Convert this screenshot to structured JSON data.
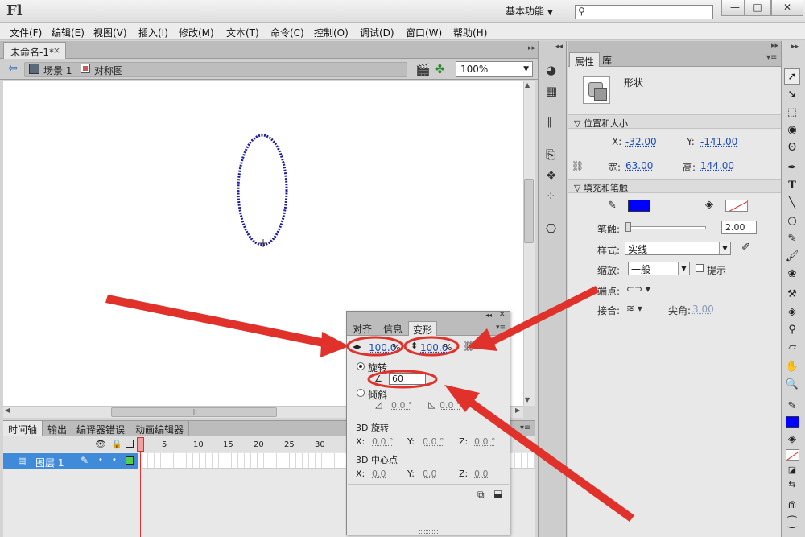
{
  "app": {
    "logo": "Fl",
    "workspace": "基本功能",
    "window_buttons": {
      "minimize": "—",
      "maximize": "□",
      "close": "✕"
    }
  },
  "menu": [
    "文件(F)",
    "编辑(E)",
    "视图(V)",
    "插入(I)",
    "修改(M)",
    "文本(T)",
    "命令(C)",
    "控制(O)",
    "调试(D)",
    "窗口(W)",
    "帮助(H)"
  ],
  "document": {
    "tab": "未命名-1*",
    "close_glyph": "×",
    "scene": "场景 1",
    "symbol": "对称图",
    "zoom": "100%"
  },
  "stage": {
    "ellipse_color": "#1c1ca0"
  },
  "timeline": {
    "tabs": [
      "时间轴",
      "输出",
      "编译器错误",
      "动画编辑器"
    ],
    "frame_numbers": [
      "1",
      "5",
      "10",
      "15",
      "20",
      "25",
      "30"
    ],
    "layer": {
      "name": "图层 1",
      "color": "#4ed24e"
    }
  },
  "properties": {
    "tabs": [
      "属性",
      "库"
    ],
    "object_type": "形状",
    "section_position": "位置和大小",
    "x_label": "X:",
    "x_value": "-32.00",
    "y_label": "Y:",
    "y_value": "-141.00",
    "width_label": "宽:",
    "width_value": "63.00",
    "height_label": "高:",
    "height_value": "144.00",
    "section_fill": "填充和笔触",
    "stroke_color": "#0000ff",
    "stroke_label": "笔触:",
    "stroke_value": "2.00",
    "style_label": "样式:",
    "style_value": "实线",
    "scale_label": "缩放:",
    "scale_value": "一般",
    "hint_label": "提示",
    "cap_label": "端点:",
    "join_label": "接合:",
    "miter_label": "尖角:",
    "miter_value": "3.00"
  },
  "transform_panel": {
    "tabs": [
      "对齐",
      "信息",
      "变形"
    ],
    "width_pct": "100.0",
    "height_pct": "100.0",
    "pct_symbol": "%",
    "rotate_label": "旋转",
    "rotate_value": "60",
    "skew_label": "倾斜",
    "skew_h": "0.0 °",
    "skew_v": "0.0 °",
    "rot3d_title": "3D 旋转",
    "rot3d_x_label": "X:",
    "rot3d_x": "0.0 °",
    "rot3d_y_label": "Y:",
    "rot3d_y": "0.0 °",
    "rot3d_z_label": "Z:",
    "rot3d_z": "0.0 °",
    "center3d_title": "3D 中心点",
    "center3d_x_label": "X:",
    "center3d_x": "0.0",
    "center3d_y_label": "Y:",
    "center3d_y": "0.0",
    "center3d_z_label": "Z:",
    "center3d_z": "0.0"
  },
  "annotation_color": "#e0312a"
}
